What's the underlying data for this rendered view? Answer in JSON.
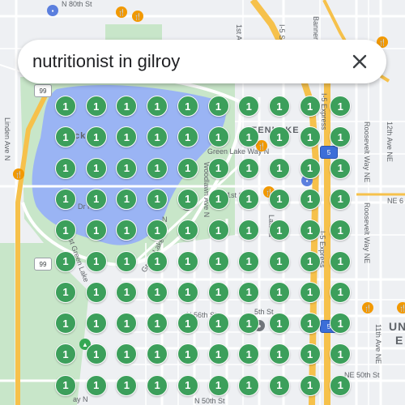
{
  "search": {
    "query": "nutritionist in gilroy",
    "clear_icon": "close-icon"
  },
  "colors": {
    "water": "#9ab4f4",
    "park": "#c8e6c9",
    "highway": "#f6c14b",
    "marker": "#3c9f5b",
    "land": "#eef0f3"
  },
  "labels": {
    "n80": "N 80th St",
    "first_ave": "1st Ave",
    "i5_top": "I-5 S",
    "banner": "Banner Way",
    "green_lake_way": "Green Lake Way N",
    "woodlawn": "Woodlawn Ave N",
    "linden": "Linden Ave N",
    "n_st_71": "1st St",
    "latona": "Latona",
    "roosevelt1": "Roosevelt Way NE",
    "roosevelt2": "Roosevelt Way NE",
    "ave12": "12th Ave NE",
    "ave11": "11th Ave NE",
    "i5_express1": "I-5 Express",
    "i5_express2": "I-5 Express",
    "n56": "N 56th St",
    "n50": "N 50th St",
    "ne50": "NE 50th St",
    "ne_right": "NE 6",
    "west_green": "West Green Lake",
    "green_lake_n": "Green Lake",
    "greenlake_area": "EENLAKE",
    "lake_label": "ck",
    "uni": "UN",
    "uni2": "E",
    "bottom_way": "ay N",
    "n_label": "N",
    "dr_n": "Dr N",
    "n5th": "5th St",
    "shield_99": "99",
    "shield_99b": "99",
    "shield_5": "5",
    "shield_5b": "5"
  },
  "grid": {
    "columns": 10,
    "rows": 10,
    "marker_label": "1"
  }
}
